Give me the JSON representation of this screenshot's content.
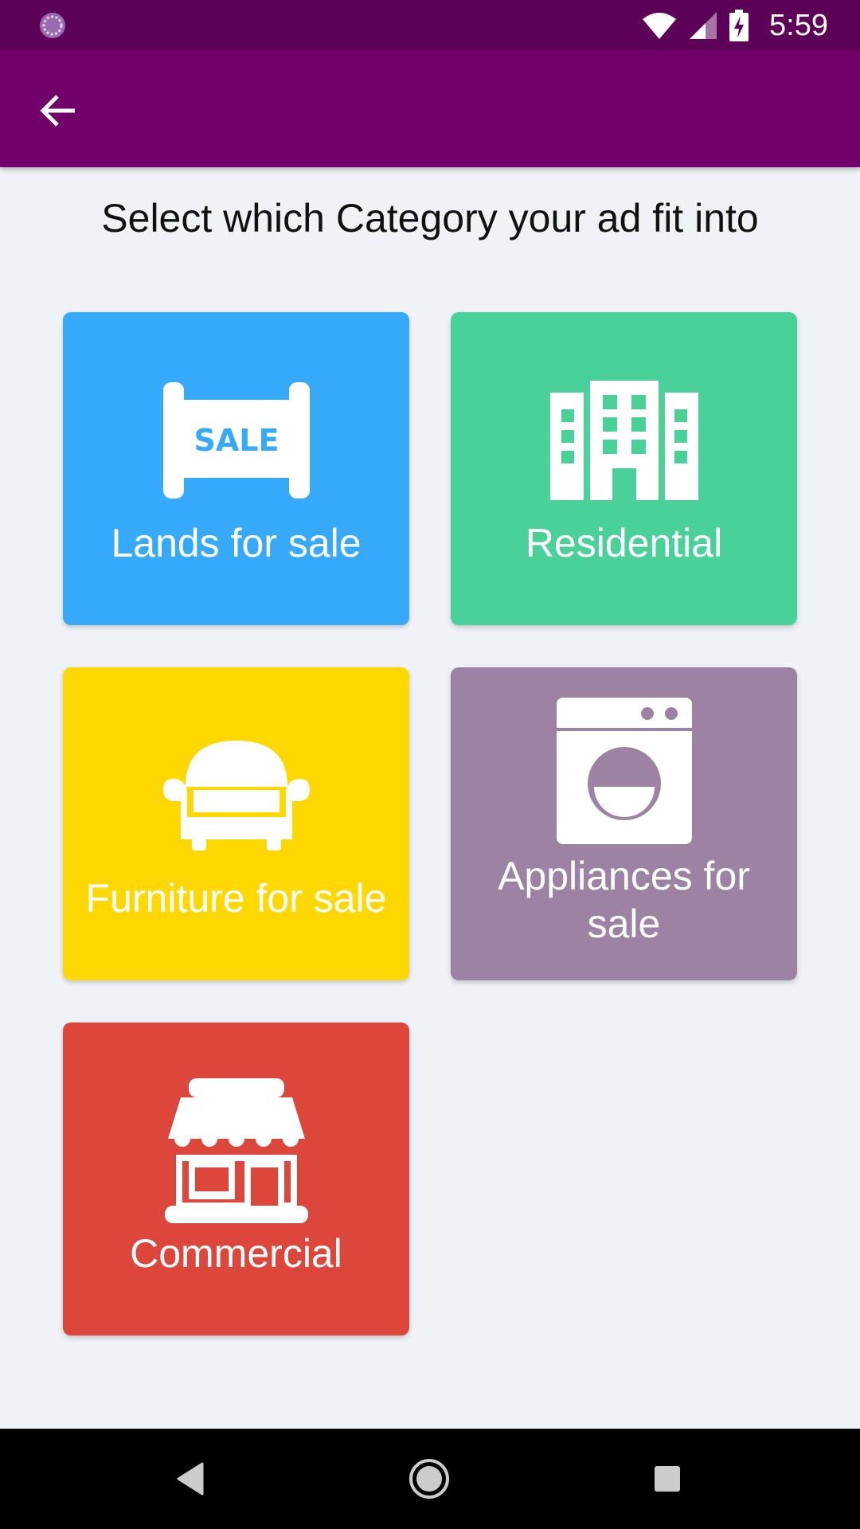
{
  "status_bar": {
    "time": "5:59",
    "icons": [
      "app-notification-icon",
      "wifi-icon",
      "signal-icon",
      "battery-charging-icon"
    ]
  },
  "app_bar": {
    "back_icon": "arrow-back-icon"
  },
  "prompt": "Select which Category your ad fit into",
  "categories": [
    {
      "label": "Lands for sale",
      "icon": "sale-sign-icon",
      "icon_text": "SALE",
      "color": "#36aaf8"
    },
    {
      "label": "Residential",
      "icon": "apartment-building-icon",
      "color": "#4ad19a"
    },
    {
      "label": "Furniture for sale",
      "icon": "armchair-icon",
      "color": "#fed800"
    },
    {
      "label": "Appliances for sale",
      "icon": "washing-machine-icon",
      "color": "#9c83a4"
    },
    {
      "label": "Commercial",
      "icon": "storefront-icon",
      "color": "#dd463b"
    }
  ],
  "nav_bar": {
    "icons": [
      "nav-back-icon",
      "nav-home-icon",
      "nav-recents-icon"
    ]
  },
  "colors": {
    "status_bar": "#5d0057",
    "app_bar": "#71006a",
    "background": "#eff3f7",
    "nav_bar": "#000000"
  }
}
